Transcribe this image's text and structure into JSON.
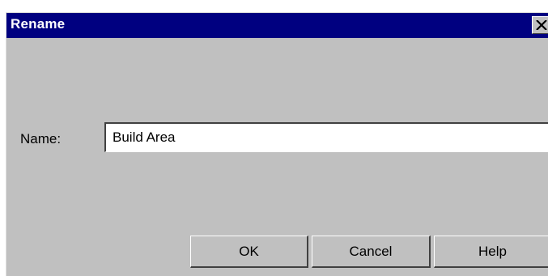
{
  "dialog": {
    "title": "Rename",
    "close_icon": "close-icon"
  },
  "form": {
    "name_label": "Name:",
    "name_value": "Build Area"
  },
  "buttons": {
    "ok_label": "OK",
    "cancel_label": "Cancel",
    "help_label": "Help"
  },
  "colors": {
    "title_bar": "#000080",
    "dialog_face": "#c0c0c0"
  }
}
